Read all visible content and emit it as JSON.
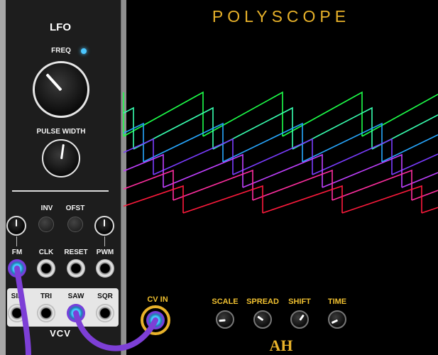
{
  "lfo": {
    "title": "LFO",
    "freq_label": "FREQ",
    "pulse_width_label": "PULSE WIDTH",
    "inv_label": "INV",
    "ofst_label": "OFST",
    "inputs": [
      "FM",
      "CLK",
      "RESET",
      "PWM"
    ],
    "outputs": [
      "SIN",
      "TRI",
      "SAW",
      "SQR"
    ],
    "brand": "VCV"
  },
  "polyscope": {
    "title": "POLYSCOPE",
    "cv_in_label": "CV IN",
    "scale_label": "SCALE",
    "spread_label": "SPREAD",
    "shift_label": "SHIFT",
    "time_label": "TIME",
    "logo": "AH"
  },
  "colors": {
    "led": "#4cc7ff",
    "cable": "#7d3fd6",
    "accent_gold": "#e8b22a"
  },
  "traces": [
    {
      "color": "#1dff4a"
    },
    {
      "color": "#38ffb0"
    },
    {
      "color": "#27a7ff"
    },
    {
      "color": "#7a3cff"
    },
    {
      "color": "#c040ff"
    },
    {
      "color": "#ff2ea0"
    },
    {
      "color": "#ff1a3c"
    }
  ]
}
